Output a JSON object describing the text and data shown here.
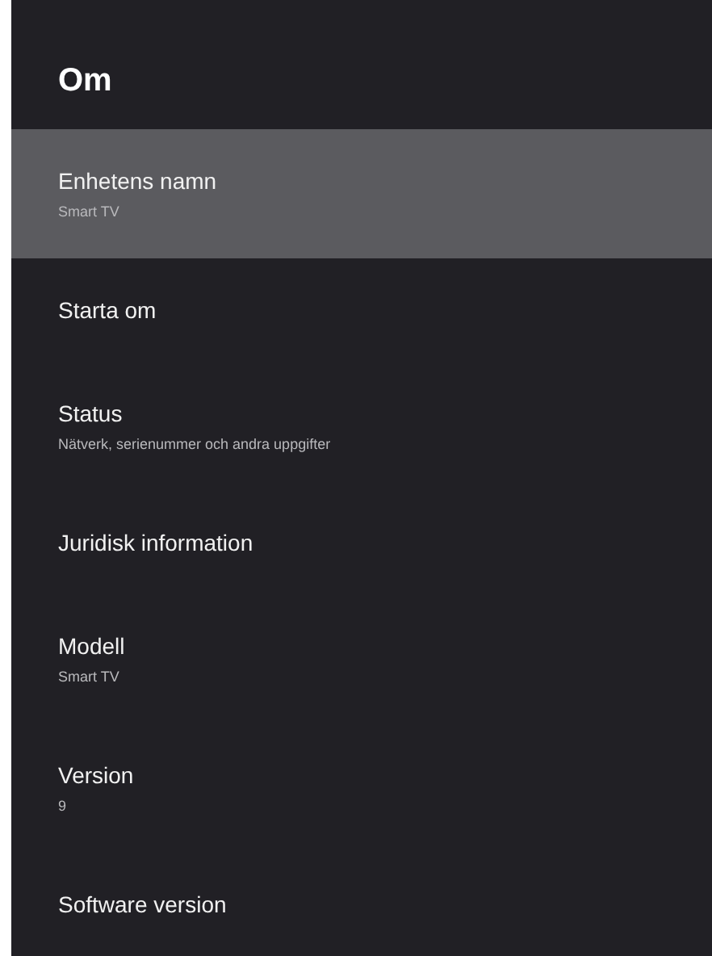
{
  "title": "Om",
  "items": [
    {
      "label": "Enhetens namn",
      "value": "Smart TV",
      "selected": true
    },
    {
      "label": "Starta om",
      "selected": false
    },
    {
      "label": "Status",
      "value": "Nätverk, serienummer och andra uppgifter",
      "selected": false
    },
    {
      "label": "Juridisk information",
      "selected": false
    },
    {
      "label": "Modell",
      "value": "Smart TV",
      "selected": false
    },
    {
      "label": "Version",
      "value": "9",
      "selected": false
    },
    {
      "label": "Software version",
      "selected": false
    }
  ]
}
